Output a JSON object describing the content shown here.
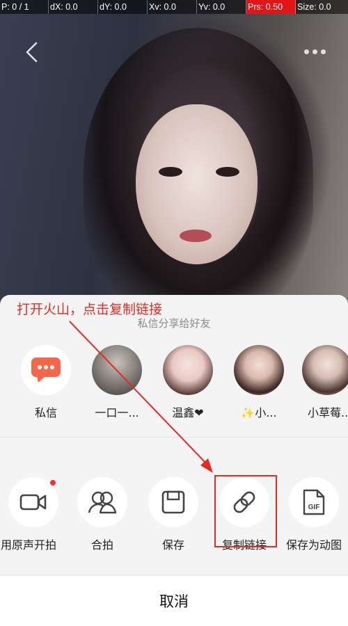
{
  "debug_bar": {
    "cells": [
      {
        "text": "P: 0 / 1",
        "alert": false
      },
      {
        "text": "dX: 0.0",
        "alert": false
      },
      {
        "text": "dY: 0.0",
        "alert": false
      },
      {
        "text": "Xv: 0.0",
        "alert": false
      },
      {
        "text": "Yv: 0.0",
        "alert": false
      },
      {
        "text": "Prs: 0.50",
        "alert": true
      },
      {
        "text": "Size: 0.0",
        "alert": false
      }
    ]
  },
  "top_controls": {
    "back_icon": "chevron-left-icon",
    "more_icon": "more-dots-icon"
  },
  "share_sheet": {
    "title": "私信分享给好友",
    "friends": [
      {
        "name": "私信",
        "icon": "message-bubble-icon"
      },
      {
        "name": "一口一..."
      },
      {
        "name": "温鑫❤"
      },
      {
        "name": "✨小..."
      },
      {
        "name": "小草莓..."
      }
    ],
    "actions": [
      {
        "label": "用原声开拍",
        "icon": "video-camera-icon",
        "has_badge": true
      },
      {
        "label": "合拍",
        "icon": "duet-people-icon",
        "has_badge": false
      },
      {
        "label": "保存",
        "icon": "save-icon",
        "has_badge": false
      },
      {
        "label": "复制链接",
        "icon": "link-icon",
        "has_badge": false
      },
      {
        "label": "保存为动图",
        "icon": "gif-file-icon",
        "has_badge": false
      }
    ],
    "cancel_label": "取消"
  },
  "annotation": {
    "text": "打开火山，点击复制链接",
    "color": "#e52b21"
  },
  "colors": {
    "accent_red": "#f2323a",
    "message_orange": "#f6664a",
    "sheet_bg": "#f4f4f4"
  }
}
